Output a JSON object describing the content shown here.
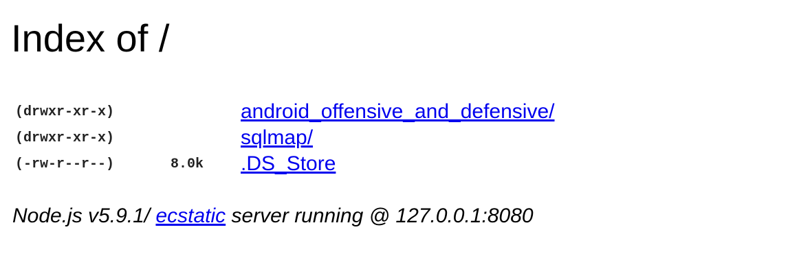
{
  "title": "Index of /",
  "entries": [
    {
      "perms": "(drwxr-xr-x)",
      "size": "",
      "name": "android_offensive_and_defensive/"
    },
    {
      "perms": "(drwxr-xr-x)",
      "size": "",
      "name": "sqlmap/"
    },
    {
      "perms": "(-rw-r--r--)",
      "size": "8.0k",
      "name": ".DS_Store"
    }
  ],
  "footer": {
    "prefix": "Node.js v5.9.1/ ",
    "link": "ecstatic",
    "suffix": " server running @ 127.0.0.1:8080"
  },
  "colors": {
    "link": "#0000ee",
    "text": "#000000",
    "background": "#ffffff"
  }
}
